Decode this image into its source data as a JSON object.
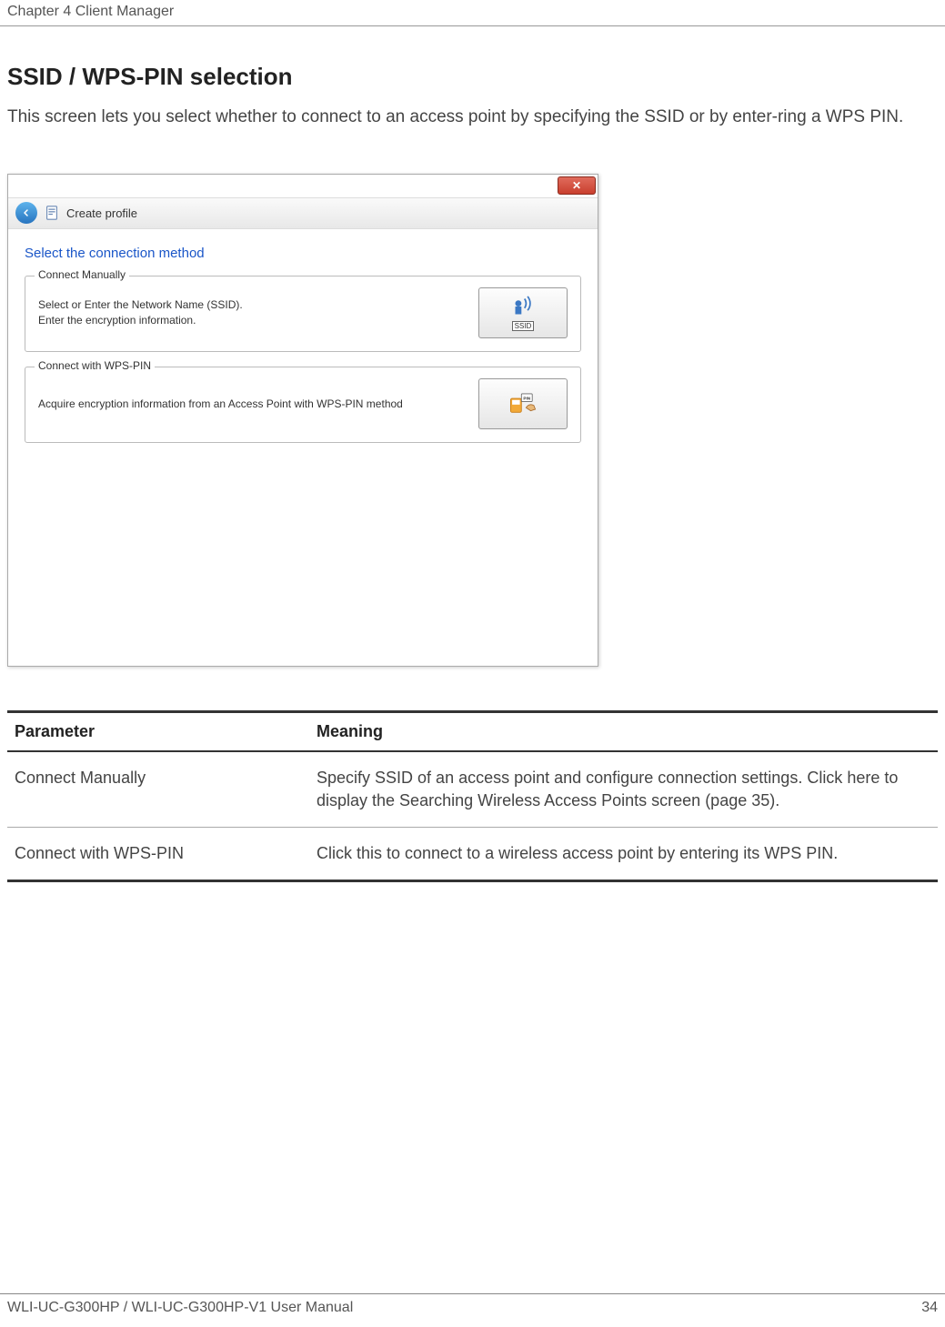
{
  "header": {
    "chapter": "Chapter 4  Client Manager"
  },
  "section": {
    "title": "SSID / WPS-PIN selection",
    "intro": "This screen lets you select whether to connect to an access point by specifying the SSID or by enter-ring a WPS PIN."
  },
  "dialog": {
    "title": "Create profile",
    "method_title": "Select the connection method",
    "option1": {
      "legend": "Connect Manually",
      "line1": "Select or Enter the Network Name (SSID).",
      "line2": "Enter the encryption information.",
      "ssid_label": "SSID"
    },
    "option2": {
      "legend": "Connect with WPS-PIN",
      "desc": "Acquire encryption information from an Access Point with WPS-PIN method"
    }
  },
  "table": {
    "col1_header": "Parameter",
    "col2_header": "Meaning",
    "rows": [
      {
        "param": "Connect Manually",
        "meaning": "Specify SSID of an access point and configure connection settings. Click here to display the Searching Wireless Access Points screen (page 35)."
      },
      {
        "param": "Connect with WPS-PIN",
        "meaning": "Click this to connect to a wireless access point by entering its WPS PIN."
      }
    ]
  },
  "footer": {
    "left": "WLI-UC-G300HP / WLI-UC-G300HP-V1 User Manual",
    "right": "34"
  }
}
